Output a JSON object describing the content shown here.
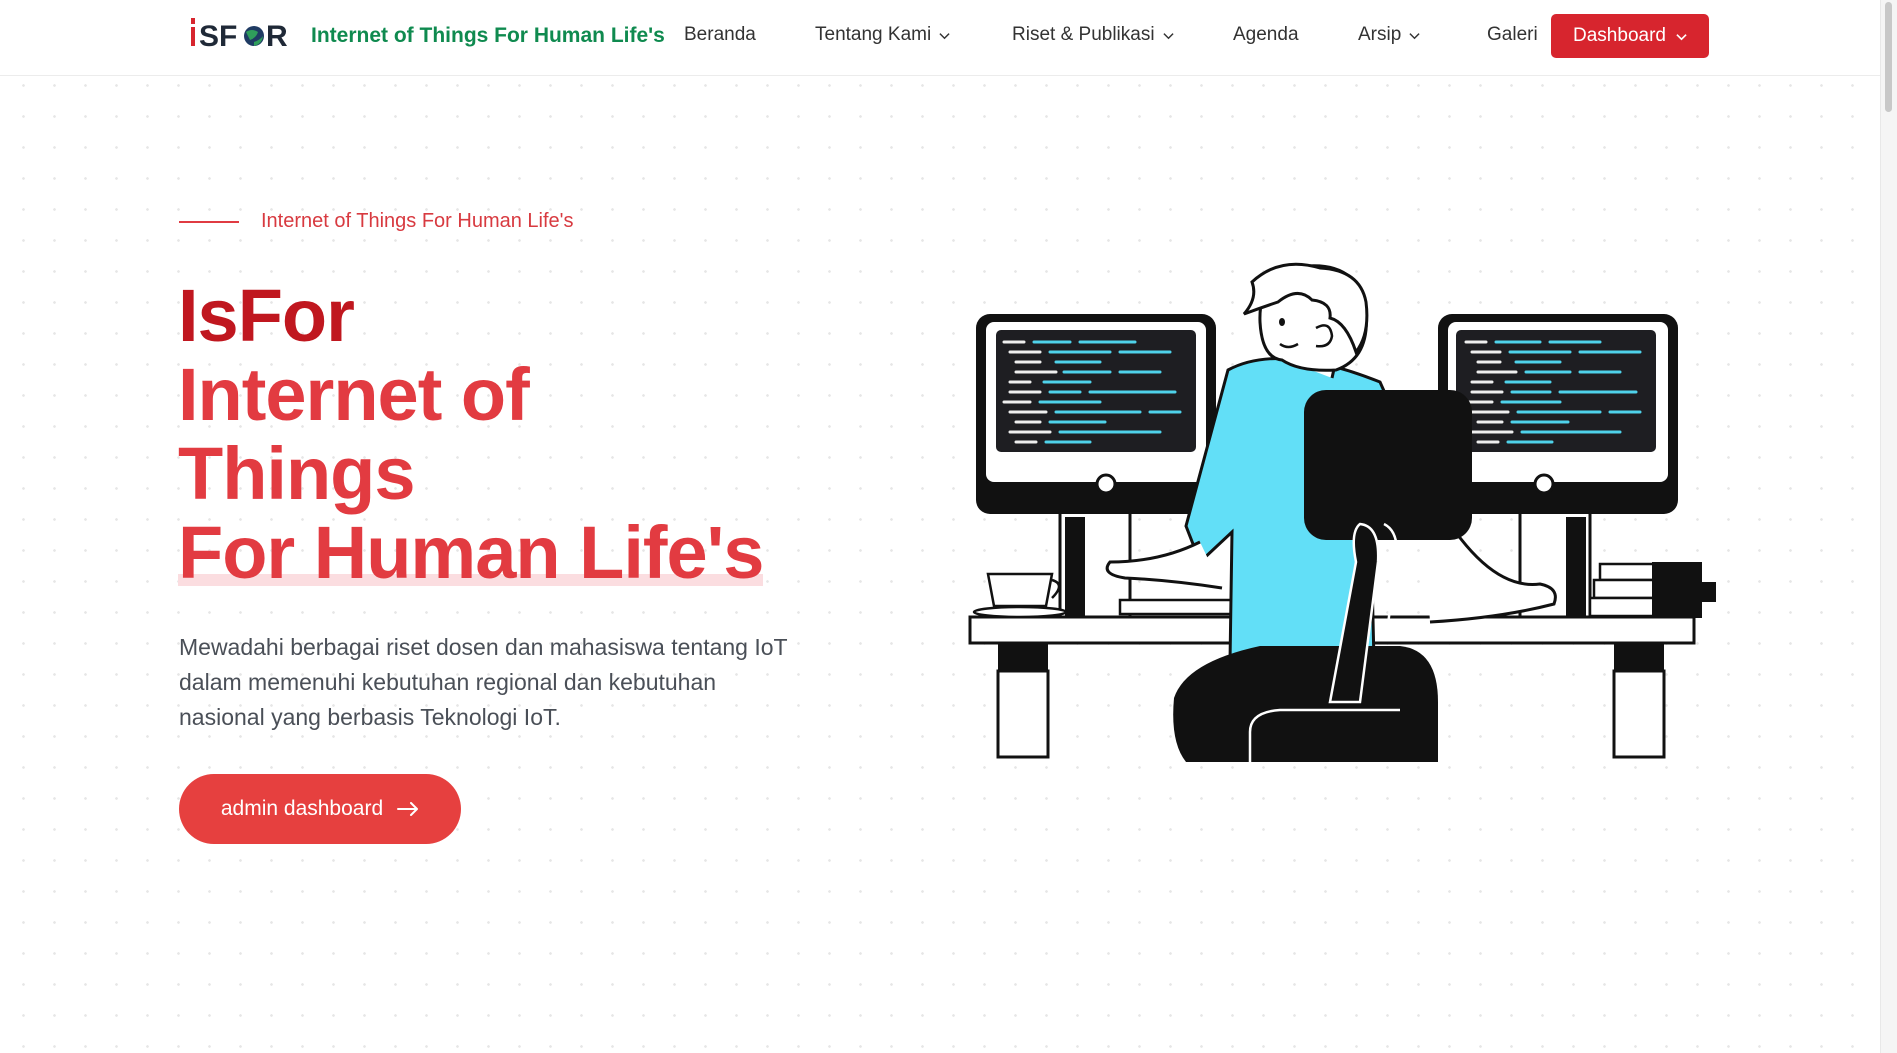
{
  "header": {
    "logo_text": "iSF●R",
    "brand_title": "Internet of Things For Human Life's",
    "nav": [
      {
        "label": "Beranda",
        "dropdown": false
      },
      {
        "label": "Tentang Kami",
        "dropdown": true
      },
      {
        "label": "Riset & Publikasi",
        "dropdown": true
      },
      {
        "label": "Agenda",
        "dropdown": false
      },
      {
        "label": "Arsip",
        "dropdown": true
      },
      {
        "label": "Galeri",
        "dropdown": false
      }
    ],
    "dashboard_button": "Dashboard"
  },
  "hero": {
    "eyebrow": "Internet of Things For Human Life's",
    "title_line1": "IsFor",
    "title_line2": "Internet of",
    "title_line3": "Things",
    "title_line4": "For Human Life's",
    "description": "Mewadahi berbagai riset dosen dan mahasiswa tentang IoT dalam memenuhi kebutuhan regional dan kebutuhan nasional yang berbasis Teknologi IoT.",
    "cta_label": "admin dashboard"
  },
  "colors": {
    "brand_red": "#d7252e",
    "title_dark_red": "#c0171f",
    "title_red": "#e23b41",
    "brand_green": "#0f8a4f",
    "shirt_cyan": "#62dff7"
  },
  "icons": {
    "dropdown": "chevron-down-icon",
    "cta_arrow": "arrow-right-icon",
    "logo_globe": "globe-icon"
  }
}
